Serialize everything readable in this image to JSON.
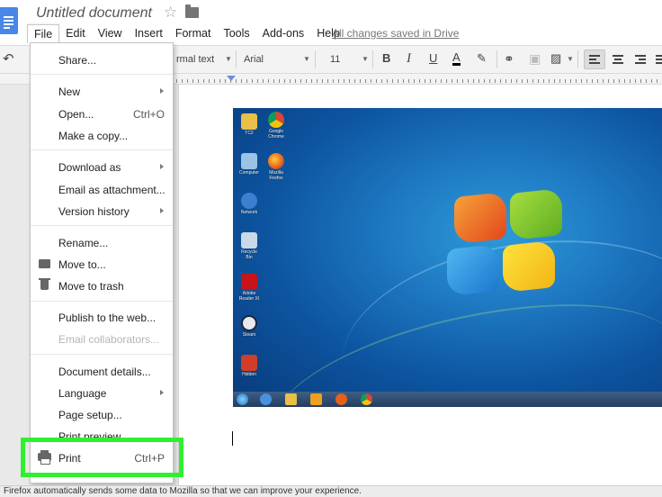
{
  "app": {
    "doc_title": "Untitled document",
    "save_status": "All changes saved in Drive"
  },
  "menubar": [
    "File",
    "Edit",
    "View",
    "Insert",
    "Format",
    "Tools",
    "Add-ons",
    "Help"
  ],
  "toolbar": {
    "style": "rmal text",
    "font": "Arial",
    "size": "11",
    "bold": "B",
    "italic": "I",
    "underline": "U",
    "text_color": "A"
  },
  "file_menu": {
    "share": "Share...",
    "new": "New",
    "open": "Open...",
    "open_shortcut": "Ctrl+O",
    "copy": "Make a copy...",
    "download": "Download as",
    "email_attachment": "Email as attachment...",
    "version_history": "Version history",
    "rename": "Rename...",
    "move_to": "Move to...",
    "trash": "Move to trash",
    "publish": "Publish to the web...",
    "email_collab": "Email collaborators...",
    "details": "Document details...",
    "language": "Language",
    "page_setup": "Page setup...",
    "print_preview": "Print preview",
    "print": "Print",
    "print_shortcut": "Ctrl+P"
  },
  "desktop_icons": [
    "TC2",
    "Google Chrome",
    "Computer",
    "Mozilla Firefox",
    "Network",
    "Recycle Bin",
    "Adobe Reader XI",
    "Steam",
    "Hidden"
  ],
  "notification": "Firefox automatically sends some data to Mozilla so that we can improve your experience.",
  "colors": {
    "highlight": "#2ff02f",
    "docs_blue": "#4a86e8"
  }
}
